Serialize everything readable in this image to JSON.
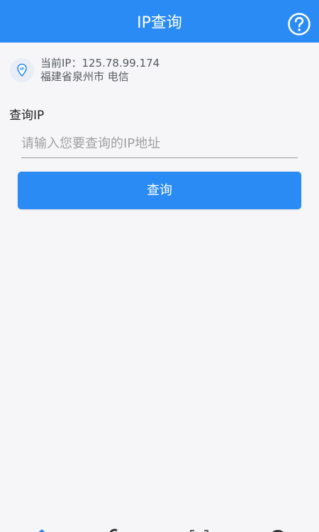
{
  "header": {
    "title": "IP查询",
    "help_icon": "help-circle-icon"
  },
  "current_ip": {
    "icon": "location-pin-icon",
    "label_line": "当前IP：125.78.99.174",
    "location_line": "福建省泉州市 电信"
  },
  "query": {
    "section_title": "查询IP",
    "placeholder": "请输入您要查询的IP地址",
    "value": "",
    "button_label": "查询"
  },
  "bottom_nav": {
    "items": [
      {
        "icon": "home-icon"
      },
      {
        "icon": "speed-icon"
      },
      {
        "icon": "scan-icon"
      },
      {
        "icon": "user-icon"
      }
    ],
    "active_color": "#2a8bf5",
    "inactive_color": "#333333"
  },
  "colors": {
    "primary": "#2a8bf5",
    "background": "#f6f6f8"
  }
}
